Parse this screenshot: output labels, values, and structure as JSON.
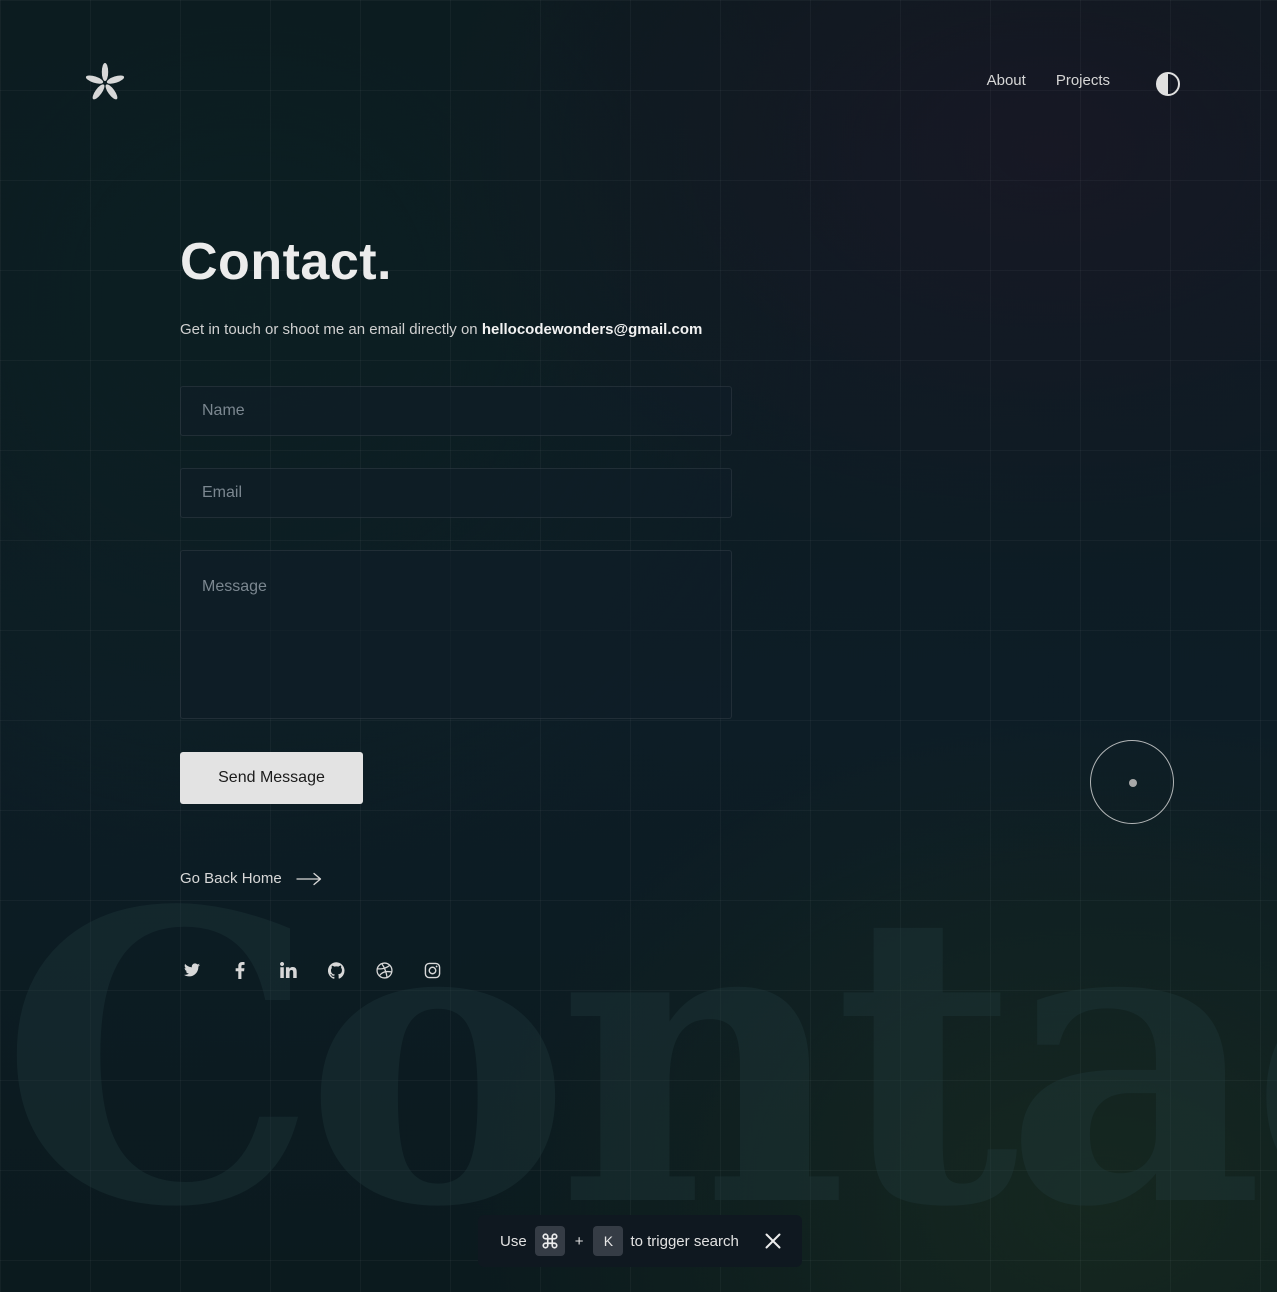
{
  "nav": {
    "links": [
      "About",
      "Projects"
    ]
  },
  "contact": {
    "title": "Contact.",
    "intro_text": "Get in touch or shoot me an email directly on ",
    "email": "hellocodewonders@gmail.com"
  },
  "form": {
    "name_placeholder": "Name",
    "email_placeholder": "Email",
    "message_placeholder": "Message",
    "submit_label": "Send Message"
  },
  "back_home": {
    "label": "Go Back Home"
  },
  "social_icons": [
    "twitter-icon",
    "facebook-icon",
    "linkedin-icon",
    "github-icon",
    "dribbble-icon",
    "instagram-icon"
  ],
  "background_word": "Contact",
  "search_hint": {
    "prefix": "Use",
    "key1_icon": "command-icon",
    "plus": "+",
    "key2": "K",
    "suffix": "to trigger search"
  },
  "colors": {
    "background": "#0c1a1f",
    "text": "#e8e8e8",
    "button_bg": "#e3e3e3"
  }
}
